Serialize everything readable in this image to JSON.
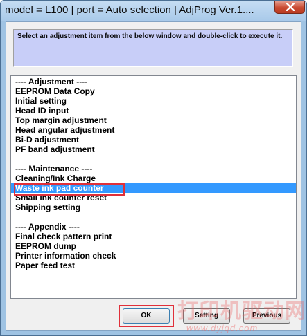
{
  "window": {
    "title": "model = L100 | port = Auto selection | AdjProg Ver.1....",
    "close_icon": "close-icon"
  },
  "instruction": "Select an adjustment item from the below window and double-click to execute it.",
  "list": {
    "items": [
      "---- Adjustment ----",
      "EEPROM Data Copy",
      "Initial setting",
      "Head ID input",
      "Top margin adjustment",
      "Head angular adjustment",
      "Bi-D adjustment",
      "PF band adjustment",
      "",
      "---- Maintenance ----",
      "Cleaning/Ink Charge",
      "Waste ink pad counter",
      "Small ink counter reset",
      "Shipping setting",
      "",
      "---- Appendix ----",
      "Final check pattern print",
      "EEPROM dump",
      "Printer information check",
      "Paper feed test"
    ],
    "selected": "Waste ink pad counter"
  },
  "buttons": {
    "ok": "OK",
    "setting": "Setting",
    "previous": "Previous"
  },
  "watermark": {
    "text": "打印机驱动网",
    "url": "www.dyjqd.com"
  },
  "colors": {
    "selection": "#3399ff",
    "highlight": "#e0303a",
    "instruction_bg": "#c8cef8"
  }
}
